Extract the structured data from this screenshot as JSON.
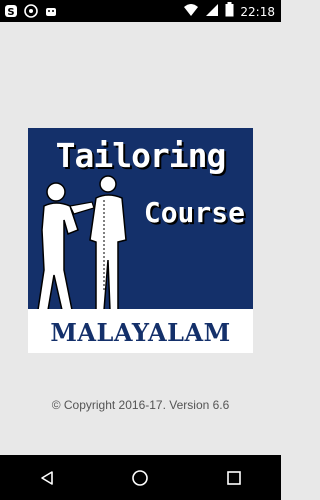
{
  "status_bar": {
    "time": "22:18",
    "left_icons": [
      "s-notification-icon",
      "whatsapp-icon",
      "android-icon"
    ],
    "right_icons": [
      "wifi-icon",
      "signal-icon",
      "battery-icon"
    ]
  },
  "splash": {
    "title_line1": "Tailoring",
    "title_line2": "Course",
    "title_line3": "MALAYALAM",
    "colors": {
      "background": "#14306a",
      "title_text": "#ffffff",
      "band": "#ffffff",
      "band_text": "#14306a"
    }
  },
  "footer": {
    "copyright": "© Copyright 2016-17. Version 6.6"
  },
  "nav_bar": {
    "buttons": [
      "back-icon",
      "home-icon",
      "recents-icon"
    ]
  }
}
